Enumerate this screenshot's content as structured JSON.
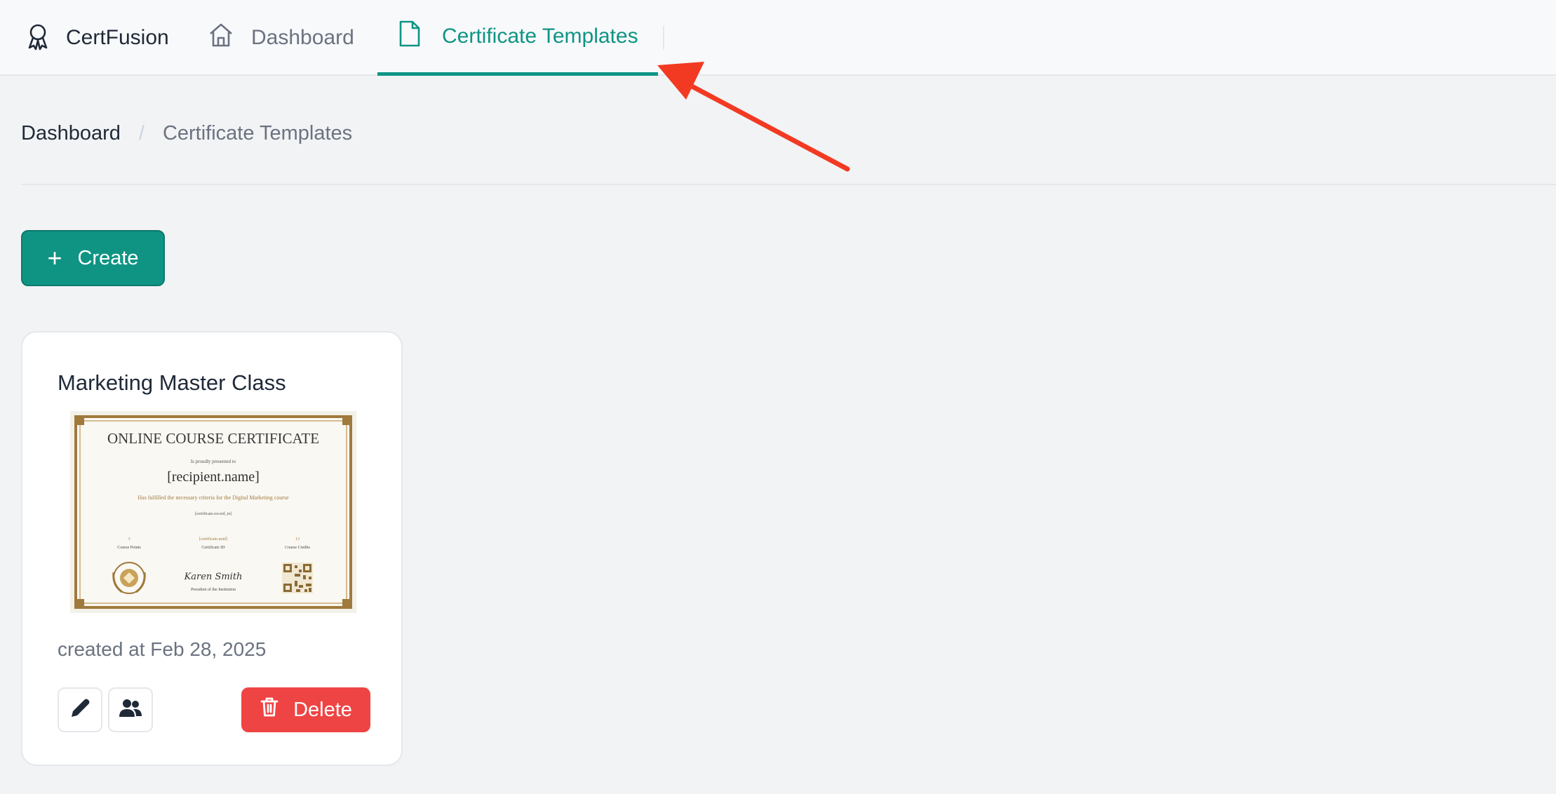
{
  "app": {
    "name": "CertFusion"
  },
  "nav": {
    "items": [
      {
        "label": "Dashboard",
        "icon": "home-icon"
      },
      {
        "label": "Certificate Templates",
        "icon": "file-icon",
        "active": true
      }
    ]
  },
  "breadcrumb": {
    "home": "Dashboard",
    "separator": "/",
    "current": "Certificate Templates"
  },
  "toolbar": {
    "create_label": "Create",
    "create_icon": "plus-icon"
  },
  "templates": [
    {
      "title": "Marketing Master Class",
      "created": "created at Feb 28, 2025",
      "delete_label": "Delete",
      "preview": {
        "heading": "ONLINE COURSE CERTIFICATE",
        "presented": "Is proudly presented to",
        "recipient": "[recipient.name]",
        "criteria": "Has fulfilled the necessary criteria for the Digital Marketing course",
        "record": "[certificate.record_in]",
        "points_value": "3",
        "points_label": "Course Points",
        "cert_id_value": "[certificate.uuid]",
        "cert_id_label": "Certificate ID",
        "credits_value": "13",
        "credits_label": "Course Credits",
        "signature": "Karen Smith",
        "signer_title": "President of the Institution"
      }
    }
  ],
  "colors": {
    "accent": "#0f9484",
    "danger": "#ef4444",
    "annotation": "#f23a22",
    "certificate_gold": "#a07a3c"
  }
}
